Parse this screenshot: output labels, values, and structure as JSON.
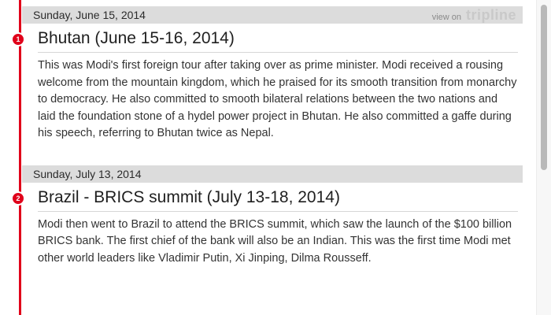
{
  "branding": {
    "view_on_label": "view on",
    "logo_text": "tripline"
  },
  "stops": [
    {
      "date": "Sunday, June 15, 2014",
      "number": "1",
      "title": "Bhutan (June 15-16, 2014)",
      "text": "This was Modi's first foreign tour after taking over as prime minister. Modi received a rousing welcome from the mountain kingdom, which he praised for its smooth transition from monarchy to democracy. He also committed to smooth bilateral relations between the two nations and laid the foundation stone of a hydel power project in Bhutan. He also committed a gaffe during his speech, referring to Bhutan twice as Nepal."
    },
    {
      "date": "Sunday, July 13, 2014",
      "number": "2",
      "title": "Brazil - BRICS summit (July 13-18, 2014)",
      "text": "Modi then went to Brazil to attend the BRICS summit, which saw the launch of the $100 billion BRICS bank. The first chief of the bank will also be an Indian. This was the first time Modi met other world leaders like Vladimir Putin, Xi Jinping, Dilma Rousseff."
    }
  ],
  "colors": {
    "timeline": "#e0001a",
    "date_bar": "#dcdcdc"
  }
}
